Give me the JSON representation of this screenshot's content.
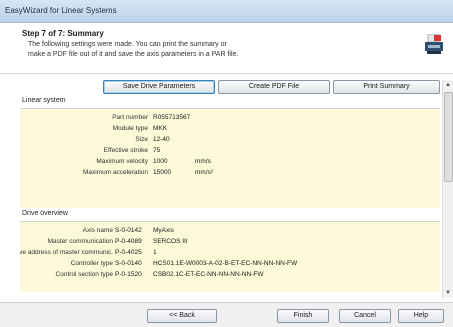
{
  "window": {
    "title": "EasyWizard for Linear Systems"
  },
  "header": {
    "step": "Step 7 of 7: Summary",
    "description_line1": "The following settings were made. You can print the summary or",
    "description_line2": "make a PDF file out of it and save the axis parameters in a PAR file."
  },
  "toolbar": {
    "save_drive": "Save Drive Parameters",
    "create_pdf": "Create PDF File",
    "print_summary": "Print Summary"
  },
  "linear_system": {
    "title": "Linear system",
    "rows": [
      {
        "label": "Part number",
        "value": "R055713567",
        "unit": ""
      },
      {
        "label": "Module type",
        "value": "MKK",
        "unit": ""
      },
      {
        "label": "Size",
        "value": "12-40",
        "unit": ""
      },
      {
        "label": "Effective stroke",
        "value": "75",
        "unit": ""
      },
      {
        "label": "Maximum velocity",
        "value": "1000",
        "unit": "mm/s"
      },
      {
        "label": "Maximum acceleration",
        "value": "15000",
        "unit": "mm/s²"
      }
    ]
  },
  "drive_overview": {
    "title": "Drive overview",
    "rows": [
      {
        "label": "Axis name",
        "param": "S-0-0142",
        "value": "MyAxis"
      },
      {
        "label": "Master communication",
        "param": "P-0-4089",
        "value": "SERCOS III"
      },
      {
        "label": "Drive address of master communic.",
        "param": "P-0-4025",
        "value": "1"
      },
      {
        "label": "Controller type",
        "param": "S-0-0140",
        "value": "HCS01.1E-W0003-A-02-B-ET-EC-NN-NN-NN-FW"
      },
      {
        "label": "Control section type",
        "param": "P-0-1520",
        "value": "CSB02.1C-ET-EC-NN-NN-NN-NN-FW"
      }
    ]
  },
  "footer": {
    "back": "<< Back",
    "finish": "Finish",
    "cancel": "Cancel",
    "help": "Help"
  }
}
